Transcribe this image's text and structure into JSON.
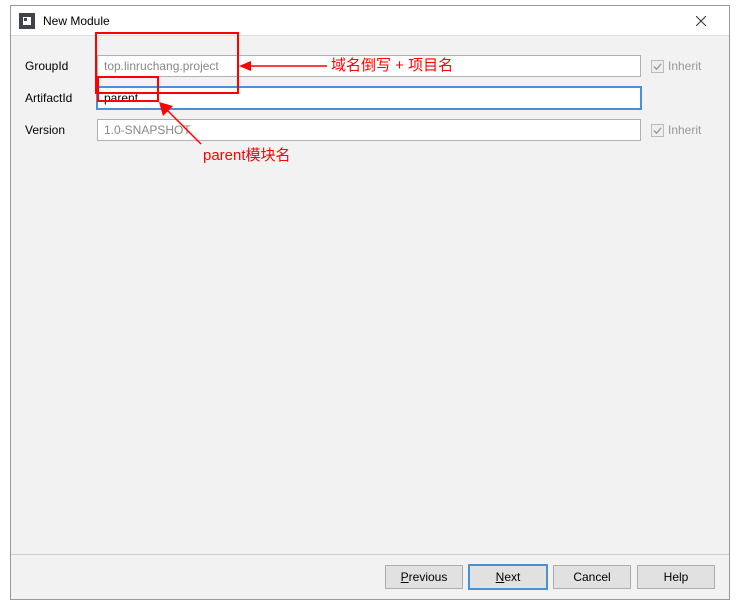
{
  "titlebar": {
    "title": "New Module"
  },
  "form": {
    "groupId": {
      "label": "GroupId",
      "value": "top.linruchang.project",
      "inherit_label": "Inherit"
    },
    "artifactId": {
      "label": "ArtifactId",
      "value": "parent"
    },
    "version": {
      "label": "Version",
      "value": "1.0-SNAPSHOT",
      "inherit_label": "Inherit"
    }
  },
  "buttons": {
    "previous": "Previous",
    "next": "Next",
    "cancel": "Cancel",
    "help": "Help"
  },
  "annotations": {
    "top_text": "域名倒写 + 项目名",
    "bottom_text": "parent模块名"
  }
}
